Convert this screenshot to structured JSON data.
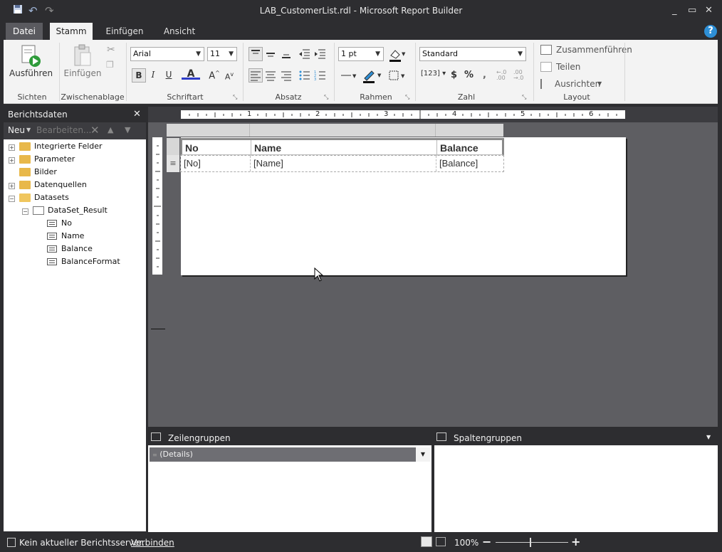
{
  "window": {
    "title": "LAB_CustomerList.rdl - Microsoft Report Builder"
  },
  "tabs": [
    {
      "label": "Datei"
    },
    {
      "label": "Stamm"
    },
    {
      "label": "Einfügen"
    },
    {
      "label": "Ansicht"
    }
  ],
  "ribbon": {
    "sichten": {
      "run_label": "Ausführen",
      "group_label": "Sichten"
    },
    "zwischenablage": {
      "paste_label": "Einfügen",
      "group_label": "Zwischenablage"
    },
    "schriftart": {
      "font_family": "Arial",
      "font_size": "11",
      "group_label": "Schriftart"
    },
    "absatz": {
      "group_label": "Absatz"
    },
    "rahmen": {
      "border_width": "1 pt",
      "group_label": "Rahmen"
    },
    "zahl": {
      "format": "Standard",
      "currency": "$",
      "percent": "%",
      "group_label": "Zahl"
    },
    "layout": {
      "merge_label": "Zusammenführen",
      "split_label": "Teilen",
      "align_label": "Ausrichten",
      "group_label": "Layout"
    }
  },
  "report_data_panel": {
    "title": "Berichtsdaten",
    "new_label": "Neu",
    "edit_label": "Bearbeiten...",
    "tree": [
      {
        "label": "Integrierte Felder"
      },
      {
        "label": "Parameter"
      },
      {
        "label": "Bilder"
      },
      {
        "label": "Datenquellen"
      },
      {
        "label": "Datasets"
      },
      {
        "label": "DataSet_Result"
      },
      {
        "label": "No"
      },
      {
        "label": "Name"
      },
      {
        "label": "Balance"
      },
      {
        "label": "BalanceFormat"
      }
    ]
  },
  "ruler": {
    "marks": [
      "1",
      "2",
      "3",
      "4",
      "5",
      "6"
    ]
  },
  "table": {
    "headers": [
      "No",
      "Name",
      "Balance"
    ],
    "row": [
      "[No]",
      "[Name]",
      "[Balance]"
    ]
  },
  "groups": {
    "row_groups_label": "Zeilengruppen",
    "column_groups_label": "Spaltengruppen",
    "details_label": "(Details)"
  },
  "status": {
    "server_text": "Kein aktueller Berichtsserver.",
    "connect_link": "Verbinden",
    "zoom": "100%"
  },
  "colors": {
    "accent": "#2e8fd6",
    "chrome": "#2d2d30",
    "canvas": "#5e5e62"
  }
}
